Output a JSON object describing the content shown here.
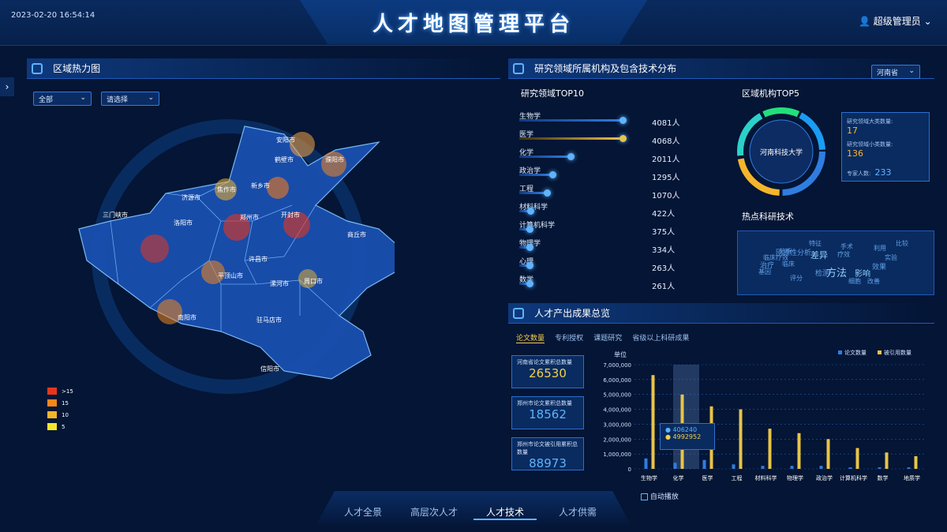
{
  "header": {
    "datetime": "2023-02-20 16:54:14",
    "title": "人才地图管理平台",
    "user": "超级管理员"
  },
  "left": {
    "title": "区域热力图",
    "filters": [
      {
        "value": "全部"
      },
      {
        "value": "请选择"
      }
    ],
    "legend": [
      {
        "label": ">15",
        "color": "#e7361e"
      },
      {
        "label": "15",
        "color": "#f5861b"
      },
      {
        "label": "10",
        "color": "#f5b52b"
      },
      {
        "label": "5",
        "color": "#f2e72d"
      }
    ],
    "cities": [
      "安阳市",
      "鹤壁市",
      "濮阳市",
      "焦作市",
      "新乡市",
      "济源市",
      "三门峡市",
      "洛阳市",
      "郑州市",
      "开封市",
      "商丘市",
      "许昌市",
      "平顶山市",
      "漯河市",
      "周口市",
      "南阳市",
      "驻马店市",
      "信阳市"
    ]
  },
  "right_top": {
    "title": "研究领域所属机构及包含技术分布",
    "province_select": "河南省",
    "top10_title": "研究领域TOP10",
    "top10": [
      {
        "label": "生物学",
        "value": "4081人"
      },
      {
        "label": "医学",
        "value": "4068人"
      },
      {
        "label": "化学",
        "value": "2011人"
      },
      {
        "label": "政治学",
        "value": "1295人"
      },
      {
        "label": "工程",
        "value": "1070人"
      },
      {
        "label": "材料科学",
        "value": "422人"
      },
      {
        "label": "计算机科学",
        "value": "375人"
      },
      {
        "label": "物理学",
        "value": "334人"
      },
      {
        "label": "心理",
        "value": "263人"
      },
      {
        "label": "数学",
        "value": "261人"
      }
    ],
    "top5_title": "区域机构TOP5",
    "ring_center": "河南科技大学",
    "stats": [
      {
        "label": "研究领域大类数量:",
        "value": "17"
      },
      {
        "label": "研究领域小类数量:",
        "value": "136"
      },
      {
        "label": "专家人数:",
        "value": "233"
      }
    ],
    "hot_title": "热点科研技术",
    "keywords": [
      "差异",
      "方法",
      "影响",
      "治疗",
      "手术",
      "检测",
      "效果",
      "分析",
      "临床",
      "利用",
      "评分",
      "基因",
      "细胞",
      "改善",
      "实验",
      "回顾性分析",
      "临床疗效",
      "疗效",
      "特征",
      "比较"
    ]
  },
  "right_bottom": {
    "title": "人才产出成果总览",
    "tabs": [
      "论文数量",
      "专利授权",
      "课题研究",
      "省级以上科研成果"
    ],
    "stat_cards": [
      {
        "label": "河南省论文累积总数量",
        "value": "26530"
      },
      {
        "label": "郑州市论文累积总数量",
        "value": "18562"
      },
      {
        "label": "郑州市论文被引用累积总数量",
        "value": "88973"
      }
    ],
    "auto_play": "自动播放",
    "tooltip": {
      "a": "406240",
      "b": "4992952"
    }
  },
  "bottom_nav": [
    "人才全景",
    "高层次人才",
    "人才技术",
    "人才供需"
  ],
  "chart_data": {
    "type": "bar",
    "ylabel": "单位",
    "ylim": [
      0,
      7000000
    ],
    "yticks": [
      "0",
      "1,000,000",
      "2,000,000",
      "3,000,000",
      "4,000,000",
      "5,000,000",
      "6,000,000",
      "7,000,000"
    ],
    "categories": [
      "生物学",
      "化学",
      "医学",
      "工程",
      "材料科学",
      "物理学",
      "政治学",
      "计算机科学",
      "数学",
      "地质学"
    ],
    "series": [
      {
        "name": "论文数量",
        "color": "#2f7de0",
        "values": [
          700000,
          406240,
          600000,
          300000,
          200000,
          200000,
          200000,
          100000,
          100000,
          100000
        ]
      },
      {
        "name": "被引用数量",
        "color": "#e8c447",
        "values": [
          6300000,
          4992952,
          4200000,
          4000000,
          2700000,
          2400000,
          2000000,
          1400000,
          1100000,
          850000
        ]
      }
    ],
    "legend": "top-right"
  }
}
